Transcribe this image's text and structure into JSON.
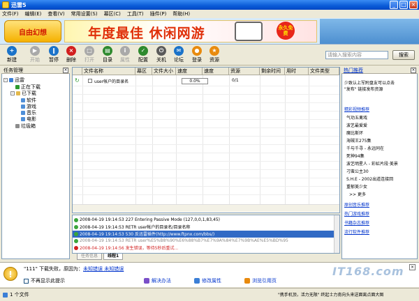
{
  "window": {
    "title": "迅雷5",
    "min": "_",
    "max": "□",
    "close": "×"
  },
  "menu": [
    "文件(F)",
    "编辑(E)",
    "查看(V)",
    "常用设置(S)",
    "幕区(C)",
    "工具(T)",
    "插件(P)",
    "帮助(H)"
  ],
  "banner": {
    "logo": "自由幻想",
    "ad_text": "年度最佳 休闲网游",
    "badge": "永久免费"
  },
  "toolbar": {
    "buttons": [
      {
        "label": "新建",
        "color": "#1b73c9",
        "glyph": "+"
      },
      {
        "label": "开始",
        "color": "#a9a9a9",
        "glyph": "▶",
        "disabled": true
      },
      {
        "label": "暂停",
        "color": "#1b73c9",
        "glyph": "‖"
      },
      {
        "label": "删除",
        "color": "#d21f1f",
        "glyph": "×"
      },
      {
        "label": "打开",
        "color": "#a9a9a9",
        "glyph": "□",
        "disabled": true
      },
      {
        "label": "目录",
        "color": "#2e8a2e",
        "glyph": "▤"
      },
      {
        "label": "属性",
        "color": "#a9a9a9",
        "glyph": "i",
        "disabled": true
      },
      {
        "label": "配置",
        "color": "#2e8a2e",
        "glyph": "✓"
      },
      {
        "label": "关机",
        "color": "#5a5a5a",
        "glyph": "⏻"
      },
      {
        "label": "论坛",
        "color": "#1b73c9",
        "glyph": "✉"
      },
      {
        "label": "登录",
        "color": "#e88a0e",
        "glyph": "●"
      },
      {
        "label": "资源",
        "color": "#e88a0e",
        "glyph": "★"
      }
    ],
    "search_placeholder": "请输入搜索内容",
    "search_button": "搜索"
  },
  "left_panel": {
    "title": "任务管理",
    "tree": {
      "root": "迅雷",
      "downloading": "正在下载",
      "downloaded": "已下载",
      "categories": [
        "软件",
        "游戏",
        "音乐",
        "电影"
      ],
      "trash": "垃圾箱"
    }
  },
  "task_table": {
    "columns": [
      "文件名称",
      "幕区",
      "文件大小",
      "速度",
      "速度",
      "资源",
      "剩余时间",
      "用时",
      "文件类型"
    ],
    "rows": [
      {
        "name": "user帐户的目录名",
        "progress": "0.0%",
        "resources": "0/1"
      }
    ]
  },
  "log": {
    "lines": [
      {
        "text": "2008-04-19 19:14:53 227 Entering Passive Mode (127,0,0,1,83,45)",
        "color": "#3aa53a"
      },
      {
        "text": "2008-04-19 19:14:53 RETR user帐户的目录名/目录名称",
        "color": "#3aa53a"
      },
      {
        "text": "2008-04-19 19:14:53 530 反迅雷插件(http://www.ftpnx.com/bbs/)",
        "color": "#3aa53a"
      },
      {
        "text": "2008-04-19 19:14:53 RETR user%E5%B8%90%E6%88%B7%E7%9A%84%E7%9B%AE%E5%BD%95",
        "color": "#3aa53a"
      },
      {
        "text": "2008-04-19 19:14:56 发生错误，等待5秒后重试...",
        "color": "#d21f1f"
      }
    ],
    "tabs": [
      "任务信息",
      "线程1"
    ]
  },
  "right_panel": {
    "title": "热门推荐",
    "intro": [
      "少致认上军附盘友可以点击",
      "\"发布\" 链接发布资源"
    ],
    "video_head": "精彩视频推荐",
    "videos": [
      "气功五禽戏",
      "波艺最爱爱",
      "魔比斯环",
      "海贼王275集",
      "千与千寻 - 永远同在",
      "死神94集",
      "波艺明星人 - 彩虹片段·美景",
      "刁蛮公主30",
      "S.H.E - 2002出道连接回",
      "重郁美少女"
    ],
    "more": ">> 更多",
    "sections": [
      "原创音乐推荐",
      "热门游戏推荐",
      "书籍杂志推荐",
      "流行软件推荐"
    ]
  },
  "notify": {
    "message_pre": "\"111\" 下载失败，原因为：",
    "message_link1": "未知错误",
    "message_mid": "  未知错误",
    "checkbox": "不再显示此提示",
    "links": [
      "解决办法",
      "修改属性",
      "浏览引用页"
    ],
    "close": "×"
  },
  "status": {
    "left": "1 个文件",
    "right": "\"携手机顶，活力无限\"  终起士力南向头来送面离点面大图",
    "watermark": "IT168.com"
  }
}
